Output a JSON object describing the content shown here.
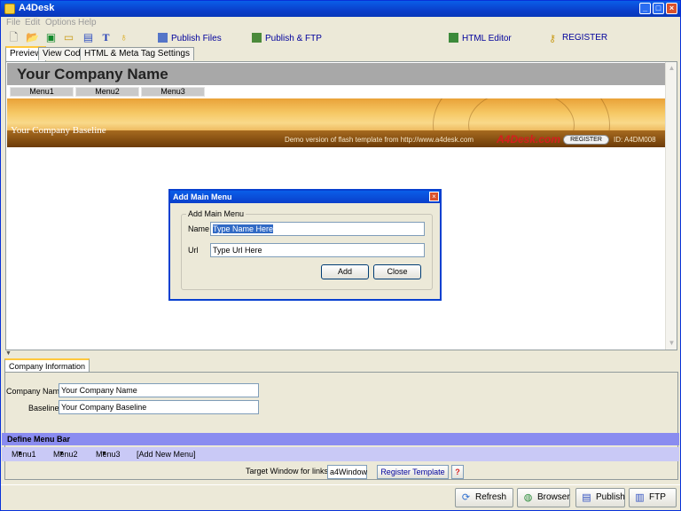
{
  "window": {
    "title": "A4Desk"
  },
  "menubar": {
    "items": [
      "File",
      "Edit",
      "Options",
      "Help"
    ]
  },
  "toolbar": {
    "publish_files": "Publish Files",
    "publish_ftp": "Publish & FTP",
    "html_editor": "HTML Editor",
    "register": "REGISTER"
  },
  "tabs": [
    "Preview",
    "View Code",
    "HTML & Meta Tag Settings"
  ],
  "preview": {
    "company_name": "Your Company Name",
    "menus": [
      "Menu1",
      "Menu2",
      "Menu3"
    ],
    "baseline": "Your Company Baseline",
    "demo_text": "Demo version of flash template from  http://www.a4desk.com",
    "brand": "A4Desk.com",
    "register_button": "REGISTER",
    "template_id": "ID: A4DM008"
  },
  "dialog": {
    "title": "Add Main Menu",
    "group_label": "Add Main Menu",
    "name_label": "Name",
    "name_value": "Type Name Here",
    "url_label": "Url",
    "url_value": "Type Url Here",
    "add_button": "Add",
    "close_button": "Close"
  },
  "company_info": {
    "tab": "Company Information",
    "company_name_label": "Company Name",
    "company_name_value": "Your Company Name",
    "baseline_label": "Baseline",
    "baseline_value": "Your Company Baseline"
  },
  "define_menu": {
    "title": "Define Menu Bar",
    "items": [
      "Menu1",
      "Menu2",
      "Menu3"
    ],
    "add_new": "[Add New Menu]"
  },
  "target": {
    "label": "Target Window for links",
    "value": "a4Window",
    "register_template": "Register Template",
    "help": "?"
  },
  "footer": {
    "refresh": "Refresh",
    "browser": "Browser",
    "publish": "Publish",
    "ftp": "FTP"
  }
}
